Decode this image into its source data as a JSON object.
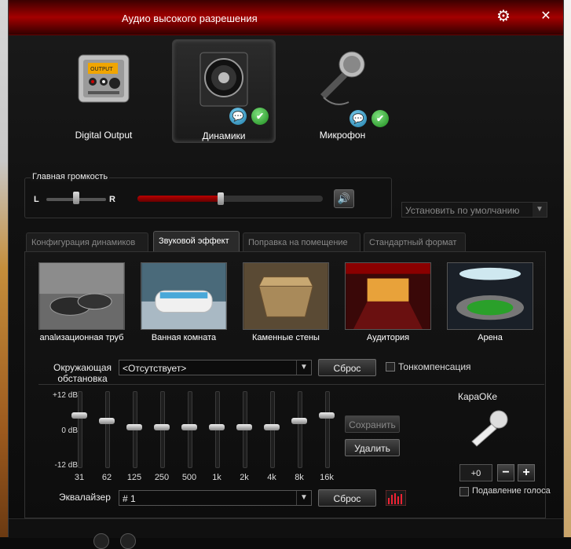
{
  "window": {
    "title": "Аудио высокого разрешения"
  },
  "devices": [
    {
      "label": "Digital Output",
      "active": false
    },
    {
      "label": "Динамики",
      "active": true
    },
    {
      "label": "Микрофон",
      "active": false
    }
  ],
  "device_art_text": {
    "output_lcd": "OUTPUT"
  },
  "volume": {
    "title": "Главная громкость",
    "left": "L",
    "right": "R",
    "balance": 0.5,
    "level": 0.45
  },
  "default_dropdown": {
    "label": "Установить по умолчанию"
  },
  "tabs": [
    {
      "label": "Конфигурация динамиков"
    },
    {
      "label": "Звуковой эффект"
    },
    {
      "label": "Поправка на помещение"
    },
    {
      "label": "Стандартный формат"
    }
  ],
  "effects": [
    {
      "label": "analизационная труб"
    },
    {
      "label": "Ванная комната"
    },
    {
      "label": "Каменные стены"
    },
    {
      "label": "Аудитория"
    },
    {
      "label": "Арена"
    }
  ],
  "environment": {
    "label": "Окружающая обстановка",
    "value": "<Отсутствует>",
    "reset": "Сброс",
    "loudness": "Тонкомпенсация"
  },
  "equalizer": {
    "scale_top": "+12 dB",
    "scale_mid": "0 dB",
    "scale_bottom": "-12 dB",
    "bands": [
      {
        "freq": "31",
        "gain": 4
      },
      {
        "freq": "62",
        "gain": 2
      },
      {
        "freq": "125",
        "gain": 0
      },
      {
        "freq": "250",
        "gain": 0
      },
      {
        "freq": "500",
        "gain": 0
      },
      {
        "freq": "1k",
        "gain": 0
      },
      {
        "freq": "2k",
        "gain": 0
      },
      {
        "freq": "4k",
        "gain": 0
      },
      {
        "freq": "8k",
        "gain": 2
      },
      {
        "freq": "16k",
        "gain": 4
      }
    ],
    "save": "Сохранить",
    "delete": "Удалить",
    "label": "Эквалайзер",
    "preset": "# 1",
    "reset": "Сброс"
  },
  "karaoke": {
    "label": "КараОКе",
    "value": "+0",
    "minus": "−",
    "plus": "+",
    "voice_cancel": "Подавление голоса"
  },
  "icons": {
    "settings": "⚙",
    "close": "✕",
    "chevron": "▼",
    "speaker": "🔊",
    "chat": "💬",
    "check": "✔"
  }
}
